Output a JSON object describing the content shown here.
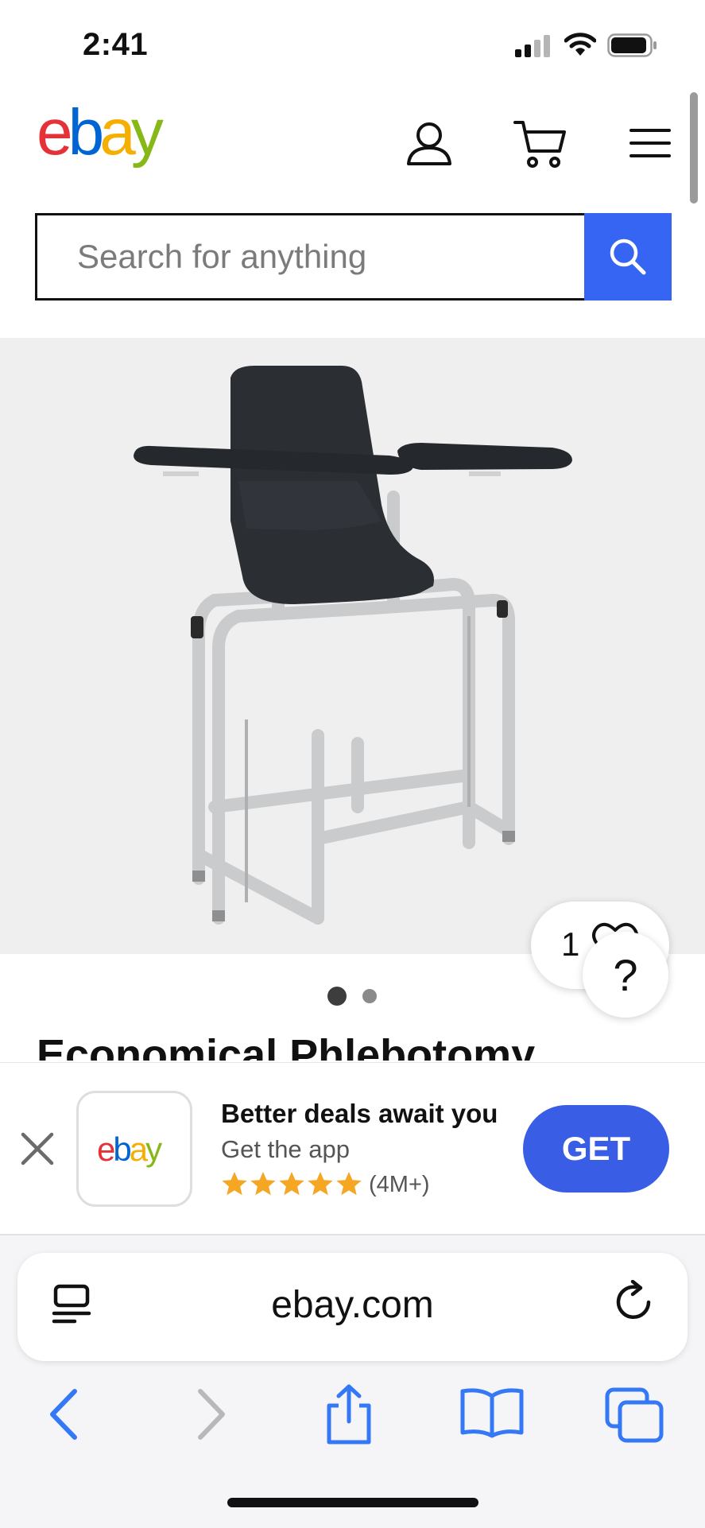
{
  "status_bar": {
    "time": "2:41",
    "signal_icon": "cellular-signal-icon",
    "wifi_icon": "wifi-icon",
    "battery_icon": "battery-icon"
  },
  "header": {
    "logo_letters": [
      "e",
      "b",
      "a",
      "y"
    ],
    "logo_colors": [
      "#e53238",
      "#0064d2",
      "#f5af02",
      "#86b817"
    ],
    "account_icon": "user-icon",
    "cart_icon": "cart-icon",
    "menu_icon": "hamburger-menu-icon"
  },
  "search": {
    "placeholder": "Search for anything",
    "button_icon": "search-icon",
    "button_color": "#3665f3"
  },
  "product": {
    "image_count": 2,
    "active_image_index": 1,
    "title": "Economical Phlebotomy",
    "watch_count": "1",
    "help_label": "?"
  },
  "app_banner": {
    "close_icon": "close-icon",
    "logo_letters": [
      "e",
      "b",
      "a",
      "y"
    ],
    "title": "Better deals await you",
    "subtitle": "Get the app",
    "stars": 5,
    "rating_count": "(4M+)",
    "get_label": "GET",
    "get_color": "#3a5de6"
  },
  "browser": {
    "url": "ebay.com",
    "reader_icon": "reader-mode-icon",
    "reload_icon": "reload-icon",
    "accent": "#3478f6"
  }
}
